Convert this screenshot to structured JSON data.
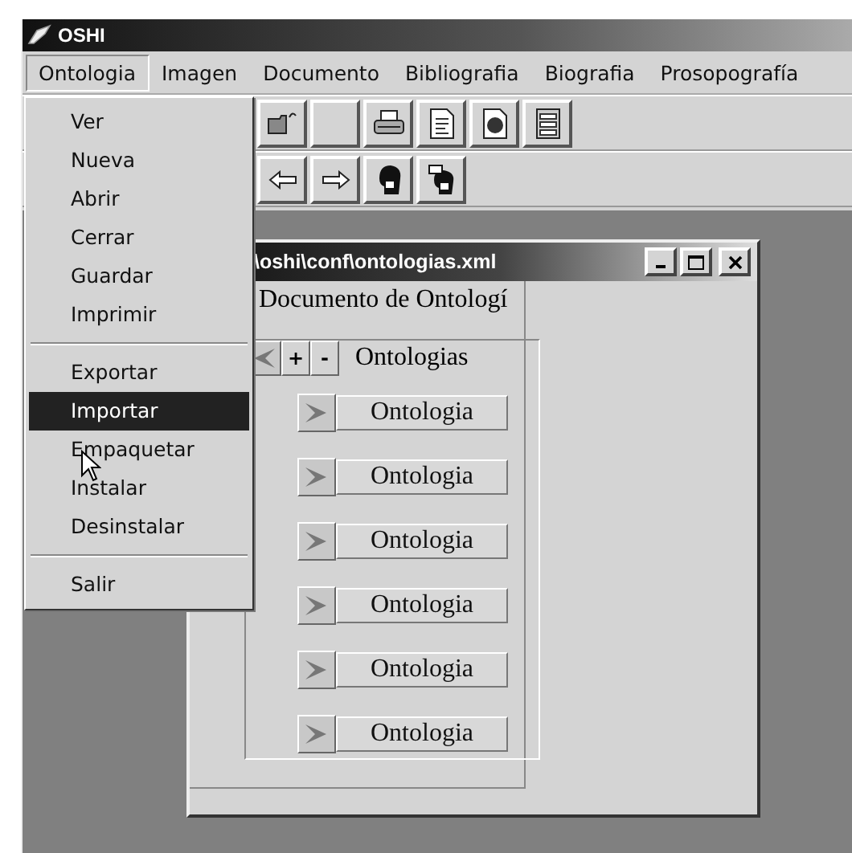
{
  "window": {
    "title": "OSHI"
  },
  "menu_bar": [
    {
      "label": "Ontologia",
      "selected": true
    },
    {
      "label": "Imagen",
      "selected": false
    },
    {
      "label": "Documento",
      "selected": false
    },
    {
      "label": "Bibliografia",
      "selected": false
    },
    {
      "label": "Biografia",
      "selected": false
    },
    {
      "label": "Prosopografía",
      "selected": false
    }
  ],
  "dropdown": [
    {
      "kind": "item",
      "label": "Ver",
      "selected": false
    },
    {
      "kind": "item",
      "label": "Nueva",
      "selected": false
    },
    {
      "kind": "item",
      "label": "Abrir",
      "selected": false
    },
    {
      "kind": "item",
      "label": "Cerrar",
      "selected": false
    },
    {
      "kind": "item",
      "label": "Guardar",
      "selected": false
    },
    {
      "kind": "item",
      "label": "Imprimir",
      "selected": false
    },
    {
      "kind": "separator"
    },
    {
      "kind": "item",
      "label": "Exportar",
      "selected": false
    },
    {
      "kind": "item",
      "label": "Importar",
      "selected": true
    },
    {
      "kind": "item",
      "label": "Empaquetar",
      "selected": false
    },
    {
      "kind": "item",
      "label": "Instalar",
      "selected": false
    },
    {
      "kind": "item",
      "label": "Desinstalar",
      "selected": false
    },
    {
      "kind": "separator"
    },
    {
      "kind": "item",
      "label": "Salir",
      "selected": false
    }
  ],
  "toolbar_1": [
    {
      "kind": "folder"
    },
    {
      "kind": "blank"
    },
    {
      "kind": "printer"
    },
    {
      "kind": "document"
    },
    {
      "kind": "globe"
    },
    {
      "kind": "list"
    }
  ],
  "toolbar_2": [
    {
      "kind": "left"
    },
    {
      "kind": "right"
    },
    {
      "kind": "head"
    },
    {
      "kind": "head-speech"
    }
  ],
  "child_window": {
    "title": "\\oshi\\conf\\ontologias.xml",
    "heading": "Documento de Ontologí",
    "tree": {
      "expand": "+",
      "collapse": "-",
      "label": "Ontologias",
      "expanded": true,
      "children": [
        {
          "label": "Ontologia"
        },
        {
          "label": "Ontologia"
        },
        {
          "label": "Ontologia"
        },
        {
          "label": "Ontologia"
        },
        {
          "label": "Ontologia"
        },
        {
          "label": "Ontologia"
        }
      ]
    }
  }
}
